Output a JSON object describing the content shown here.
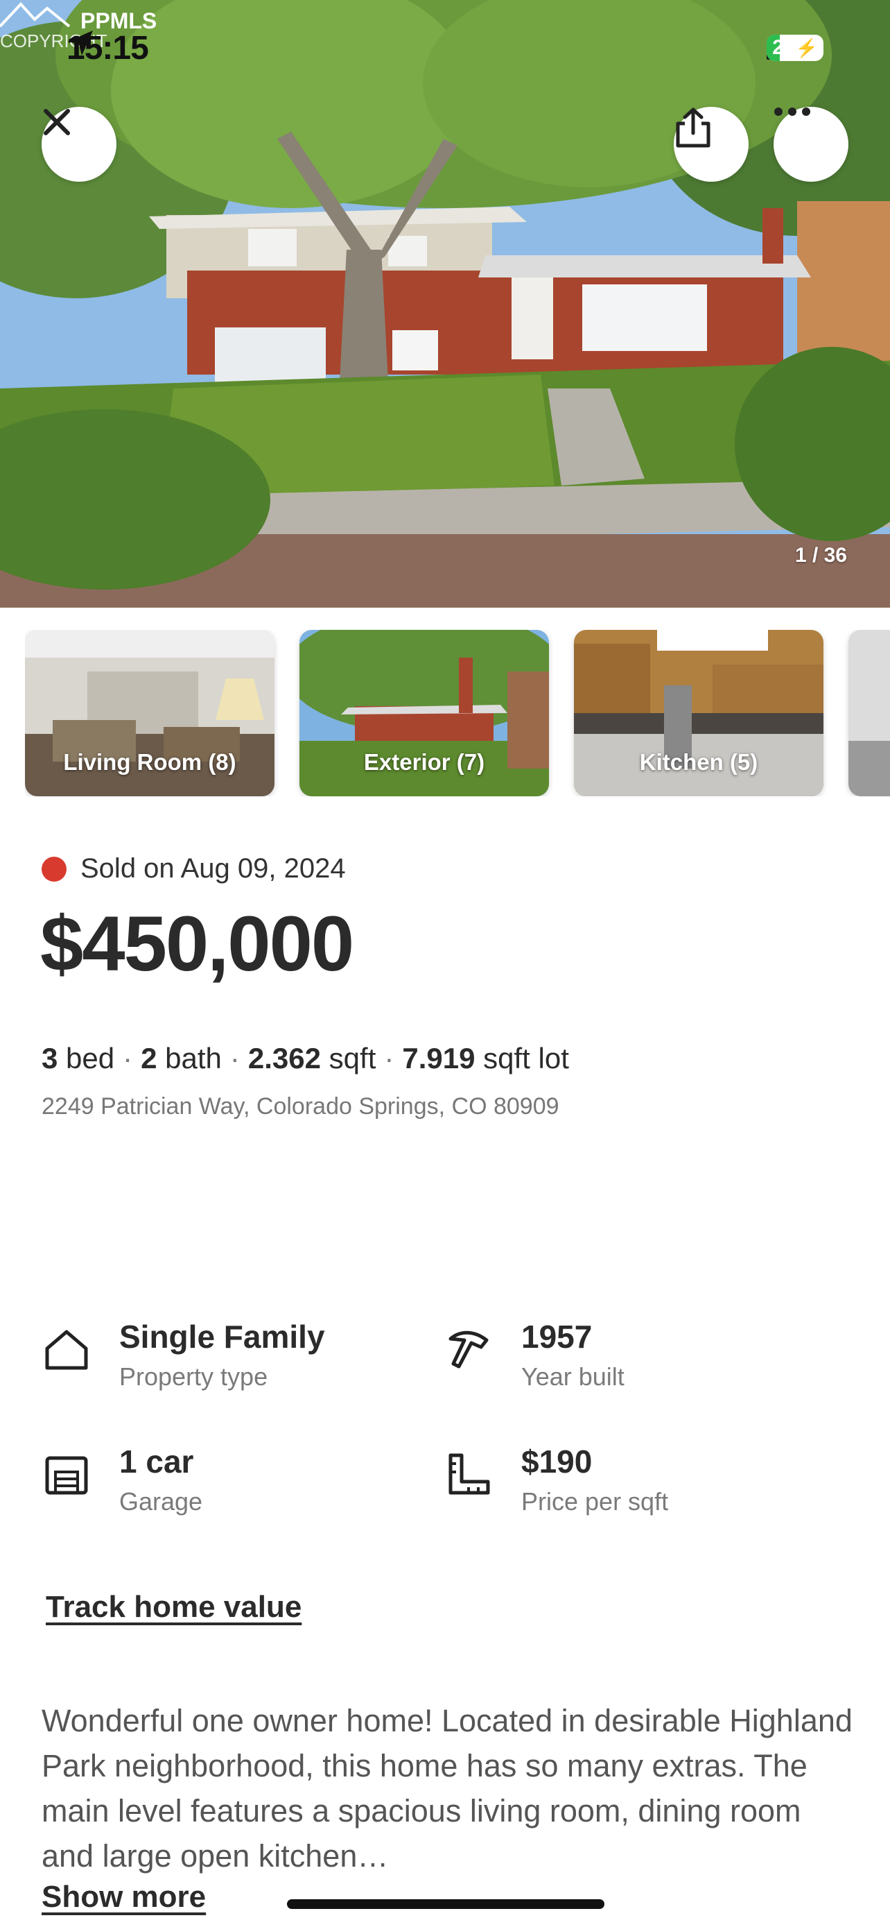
{
  "status_bar": {
    "time": "15:15",
    "battery": "23",
    "battery_level": 0.23
  },
  "watermark": {
    "brand": "PPMLS",
    "copy": "COPYRIGHT"
  },
  "gallery": {
    "counter": "1 / 36"
  },
  "thumbnails": [
    {
      "label": "Living Room (8)"
    },
    {
      "label": "Exterior (7)"
    },
    {
      "label": "Kitchen (5)"
    }
  ],
  "listing": {
    "status": "Sold on Aug 09, 2024",
    "status_color": "#d83a2e",
    "price": "$450,000",
    "beds": "3",
    "beds_label": "bed",
    "baths": "2",
    "baths_label": "bath",
    "sqft": "2.362",
    "sqft_label": "sqft",
    "lot": "7.919",
    "lot_label": "sqft lot",
    "address": "2249 Patrician Way, Colorado Springs, CO 80909"
  },
  "details": [
    {
      "value": "Single Family",
      "label": "Property type",
      "icon": "house-icon"
    },
    {
      "value": "1957",
      "label": "Year built",
      "icon": "hammer-icon"
    },
    {
      "value": "1 car",
      "label": "Garage",
      "icon": "garage-icon"
    },
    {
      "value": "$190",
      "label": "Price per sqft",
      "icon": "ruler-icon"
    }
  ],
  "actions": {
    "track": "Track home value",
    "show_more": "Show more"
  },
  "description": "Wonderful one owner home! Located in desirable Highland Park neighborhood, this home has so many extras. The main level features a spacious living room, dining room and large open kitchen…"
}
